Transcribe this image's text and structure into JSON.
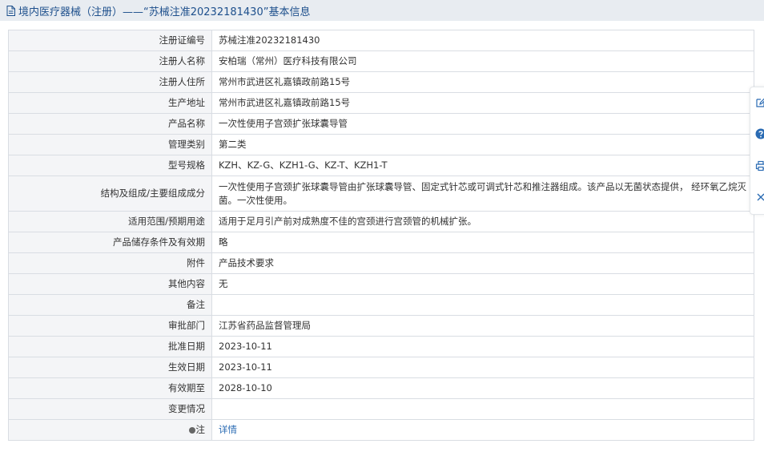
{
  "header": {
    "title": "境内医疗器械（注册）——“苏械注准20232181430”基本信息"
  },
  "rows": [
    {
      "label": "注册证编号",
      "value": "苏械注准20232181430"
    },
    {
      "label": "注册人名称",
      "value": "安柏瑞（常州）医疗科技有限公司"
    },
    {
      "label": "注册人住所",
      "value": "常州市武进区礼嘉镇政前路15号"
    },
    {
      "label": "生产地址",
      "value": "常州市武进区礼嘉镇政前路15号"
    },
    {
      "label": "产品名称",
      "value": "一次性使用子宫颈扩张球囊导管"
    },
    {
      "label": "管理类别",
      "value": "第二类"
    },
    {
      "label": "型号规格",
      "value": "KZH、KZ-G、KZH1-G、KZ-T、KZH1-T"
    },
    {
      "label": "结构及组成/主要组成成分",
      "value": "一次性使用子宫颈扩张球囊导管由扩张球囊导管、固定式针芯或可调式针芯和推注器组成。该产品以无菌状态提供， 经环氧乙烷灭菌。一次性使用。"
    },
    {
      "label": "适用范围/预期用途",
      "value": "适用于足月引产前对成熟度不佳的宫颈进行宫颈管的机械扩张。"
    },
    {
      "label": "产品储存条件及有效期",
      "value": "略"
    },
    {
      "label": "附件",
      "value": "产品技术要求"
    },
    {
      "label": "其他内容",
      "value": "无"
    },
    {
      "label": "备注",
      "value": ""
    },
    {
      "label": "审批部门",
      "value": "江苏省药品监督管理局"
    },
    {
      "label": "批准日期",
      "value": "2023-10-11"
    },
    {
      "label": "生效日期",
      "value": "2023-10-11"
    },
    {
      "label": "有效期至",
      "value": "2028-10-10"
    },
    {
      "label": "变更情况",
      "value": ""
    },
    {
      "label": "注",
      "value": "详情"
    }
  ],
  "colors": {
    "accent": "#1d4f8c",
    "link": "#2a6bb3",
    "label_bg": "#f4f5f7",
    "header_bg": "#e8ecf1",
    "border": "#d9dde3"
  },
  "icons": [
    "document-icon",
    "pin-icon",
    "edit-icon",
    "help-icon",
    "print-icon",
    "close-icon"
  ]
}
